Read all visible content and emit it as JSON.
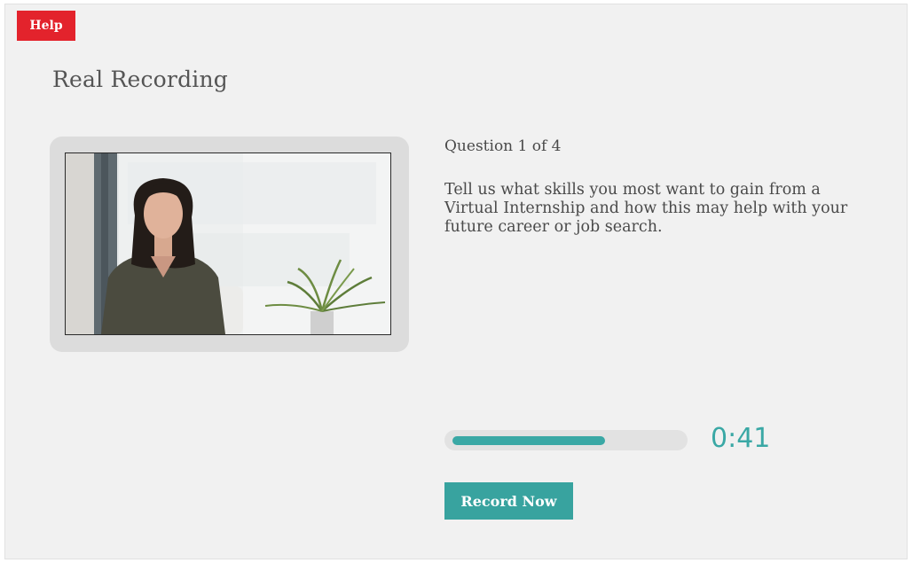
{
  "help": {
    "label": "Help"
  },
  "page": {
    "title": "Real Recording"
  },
  "question": {
    "counter": "Question 1 of 4",
    "text": "Tell us what skills you most want to gain from a Virtual Internship and how this may help with your future career or job search."
  },
  "recording": {
    "progress_fraction": 0.67,
    "timer": "0:41",
    "record_label": "Record Now"
  },
  "colors": {
    "accent": "#3aa8a5",
    "help": "#e3232c",
    "background": "#f1f1f1"
  },
  "icons": {
    "video": "webcam-preview"
  }
}
